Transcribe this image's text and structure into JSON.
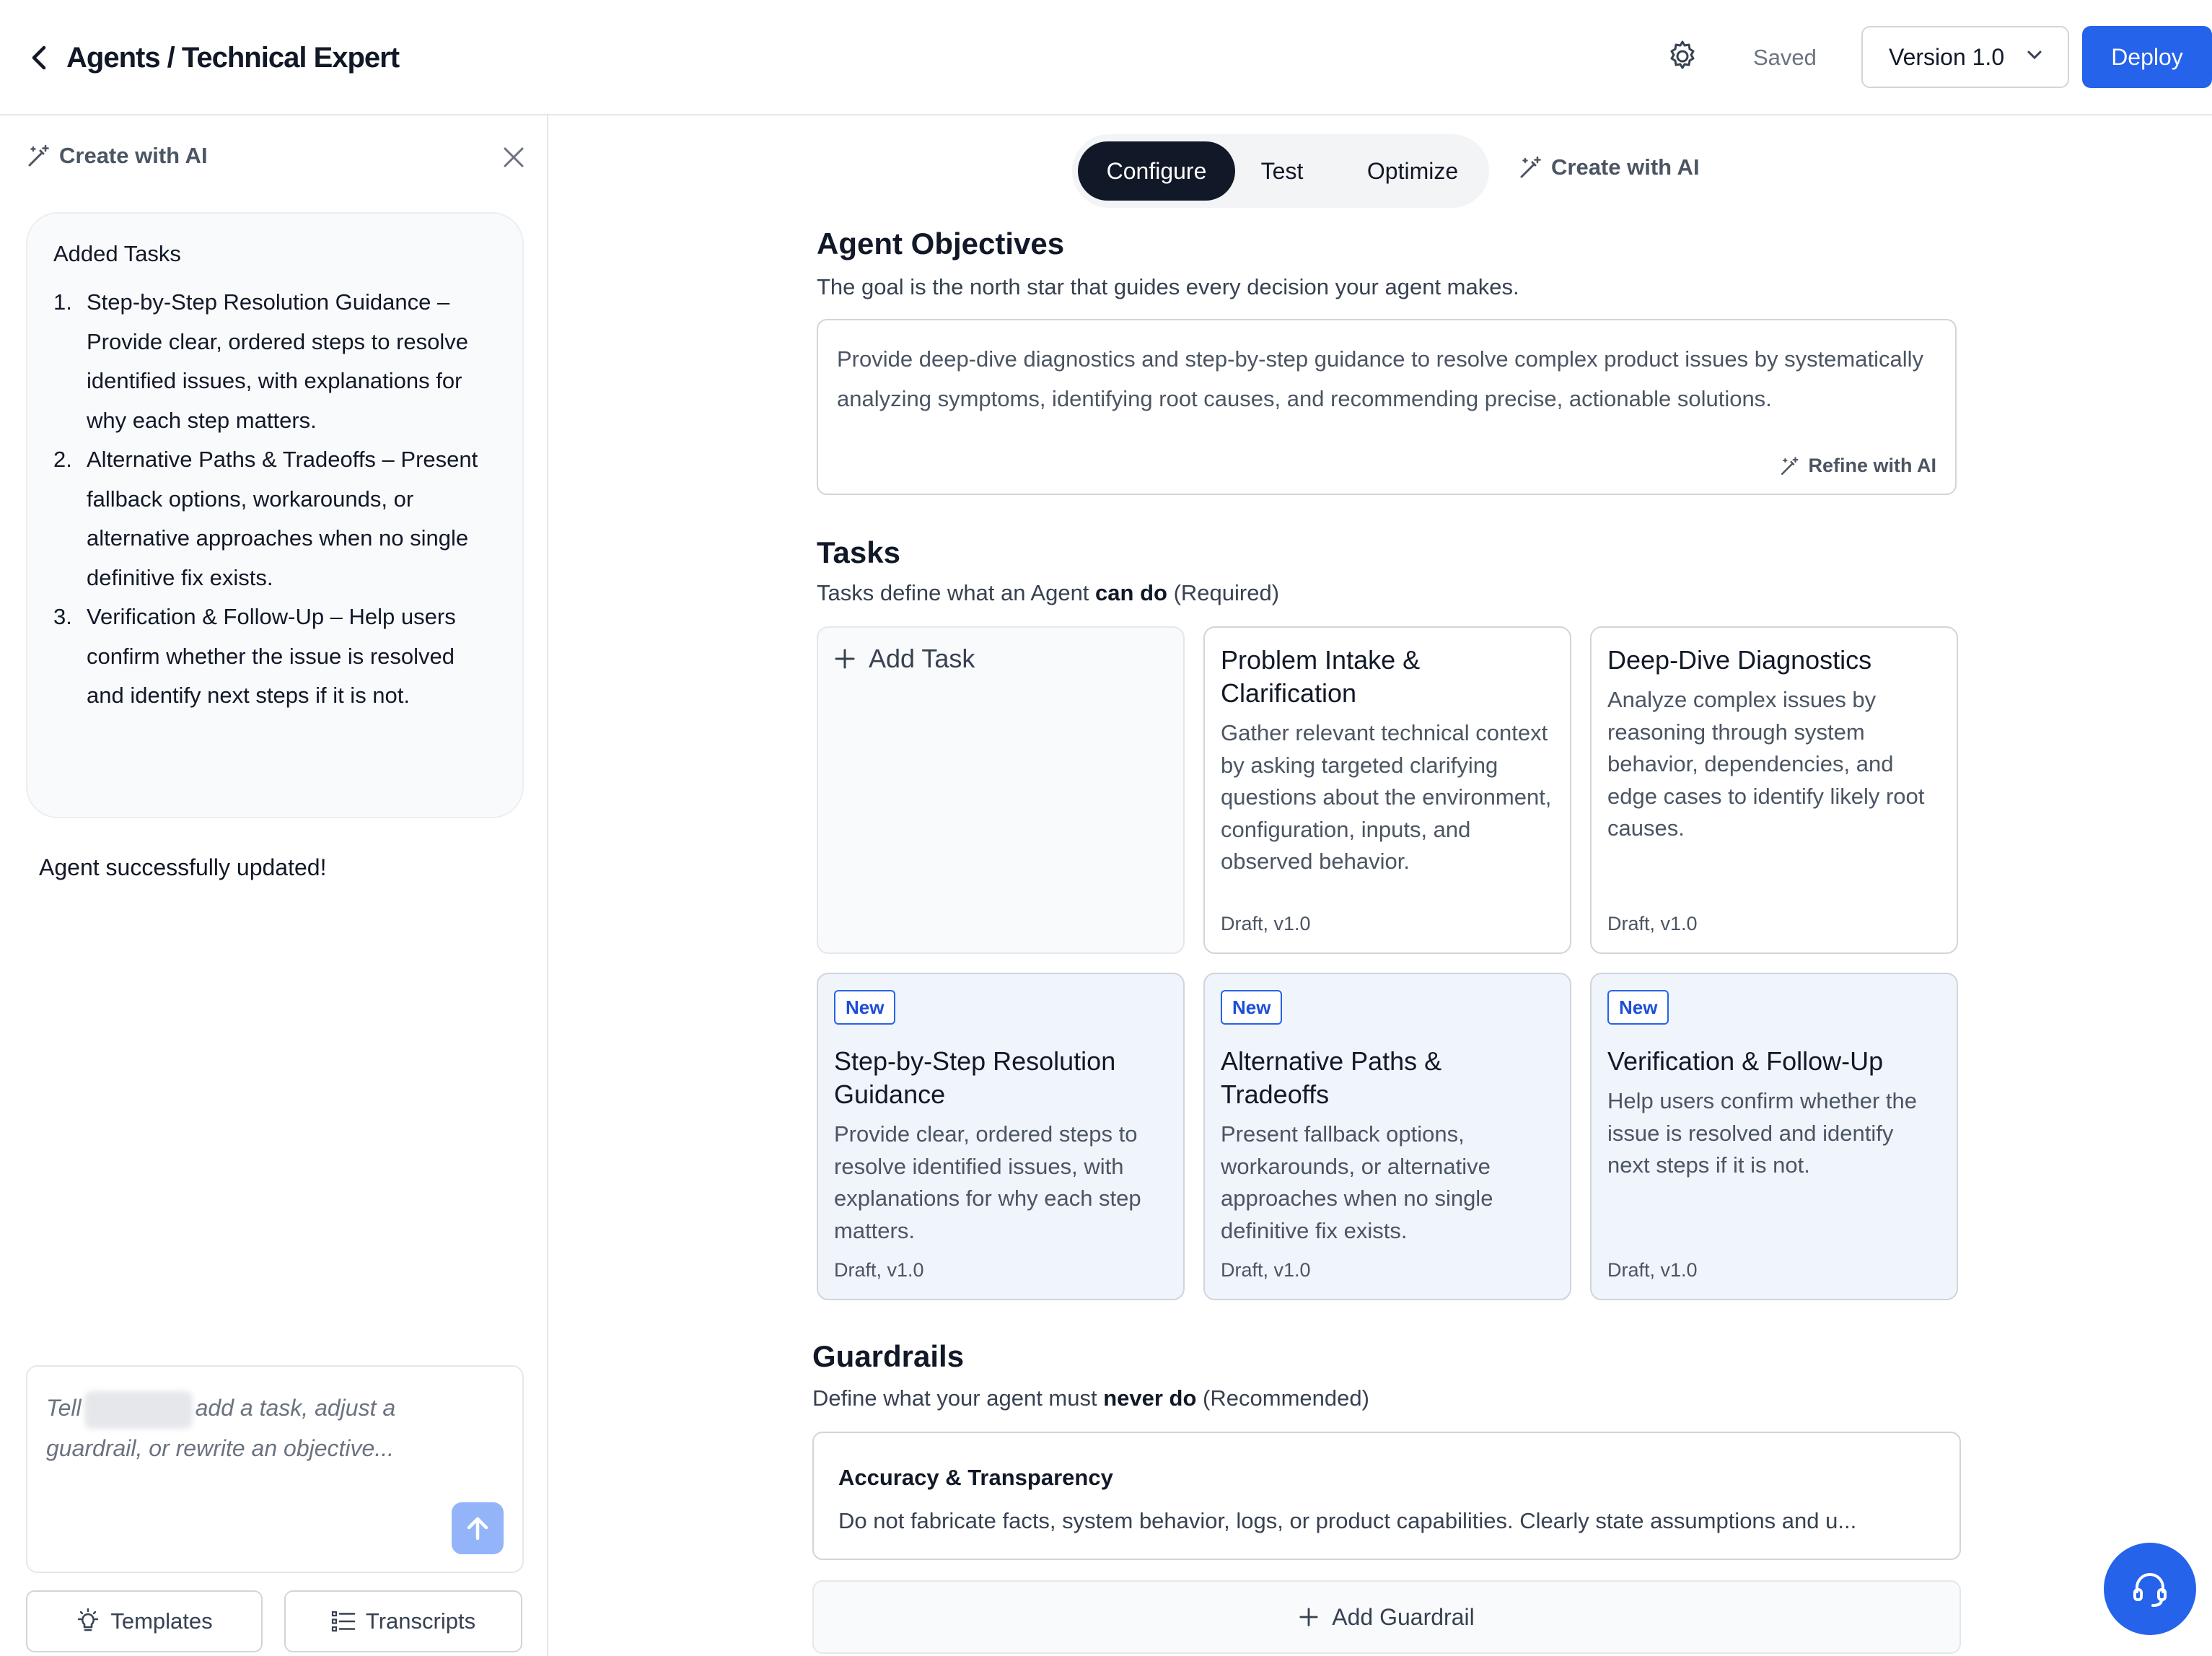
{
  "header": {
    "breadcrumb": "Agents / Technical Expert",
    "saved_label": "Saved",
    "version_label": "Version 1.0",
    "deploy_label": "Deploy"
  },
  "sidebar": {
    "title": "Create with AI",
    "added_tasks_title": "Added Tasks",
    "tasks": [
      {
        "num": "1.",
        "text": "Step-by-Step Resolution Guidance – Provide clear, ordered steps to resolve identified issues, with explanations for why each step matters."
      },
      {
        "num": "2.",
        "text": "Alternative Paths & Tradeoffs – Present fallback options, workarounds, or alternative approaches when no single definitive fix exists."
      },
      {
        "num": "3.",
        "text": "Verification & Follow-Up – Help users confirm whether the issue is resolved and identify next steps if it is not."
      }
    ],
    "success_message": "Agent successfully updated!",
    "chat_placeholder_prefix": "Tell",
    "chat_placeholder_suffix": "add a task, adjust a guardrail, or rewrite an objective...",
    "templates_label": "Templates",
    "transcripts_label": "Transcripts"
  },
  "tabs": {
    "configure": "Configure",
    "test": "Test",
    "optimize": "Optimize",
    "create_with_ai": "Create with AI"
  },
  "objectives": {
    "title": "Agent Objectives",
    "subtitle": "The goal is the north star that guides every decision your agent makes.",
    "text": "Provide deep-dive diagnostics and step-by-step guidance to resolve complex product issues by systematically analyzing symptoms, identifying root causes, and recommending precise, actionable solutions.",
    "refine_label": "Refine with AI"
  },
  "tasks": {
    "title": "Tasks",
    "subtitle_pre": "Tasks define what an Agent ",
    "subtitle_bold": "can do",
    "subtitle_post": " (Required)",
    "add_task_label": "Add Task",
    "cards": [
      {
        "title": "Problem Intake & Clarification",
        "desc": "Gather relevant technical context by asking targeted clarifying questions about the environment, configuration, inputs, and observed behavior.",
        "status": "Draft, v1.0",
        "badge": ""
      },
      {
        "title": "Deep-Dive Diagnostics",
        "desc": "Analyze complex issues by reasoning through system behavior, dependencies, and edge cases to identify likely root causes.",
        "status": "Draft, v1.0",
        "badge": ""
      },
      {
        "title": "Step-by-Step Resolution Guidance",
        "desc": "Provide clear, ordered steps to resolve identified issues, with explanations for why each step matters.",
        "status": "Draft, v1.0",
        "badge": "New"
      },
      {
        "title": "Alternative Paths & Tradeoffs",
        "desc": "Present fallback options, workarounds, or alternative approaches when no single definitive fix exists.",
        "status": "Draft, v1.0",
        "badge": "New"
      },
      {
        "title": "Verification & Follow-Up",
        "desc": "Help users confirm whether the issue is resolved and identify next steps if it is not.",
        "status": "Draft, v1.0",
        "badge": "New"
      }
    ]
  },
  "guardrails": {
    "title": "Guardrails",
    "subtitle_pre": "Define what your agent must ",
    "subtitle_bold": "never do",
    "subtitle_post": " (Recommended)",
    "items": [
      {
        "title": "Accuracy & Transparency",
        "desc": "Do not fabricate facts, system behavior, logs, or product capabilities. Clearly state assumptions and u..."
      }
    ],
    "add_label": "Add Guardrail"
  },
  "colors": {
    "accent": "#2563eb",
    "active_tab": "#111827",
    "new_card_bg": "#f0f4fb"
  },
  "icons": [
    "back-chevron-icon",
    "gear-icon",
    "chevron-down-icon",
    "magic-wand-icon",
    "close-icon",
    "arrow-up-icon",
    "lightbulb-icon",
    "list-icon",
    "plus-icon",
    "headset-icon"
  ]
}
